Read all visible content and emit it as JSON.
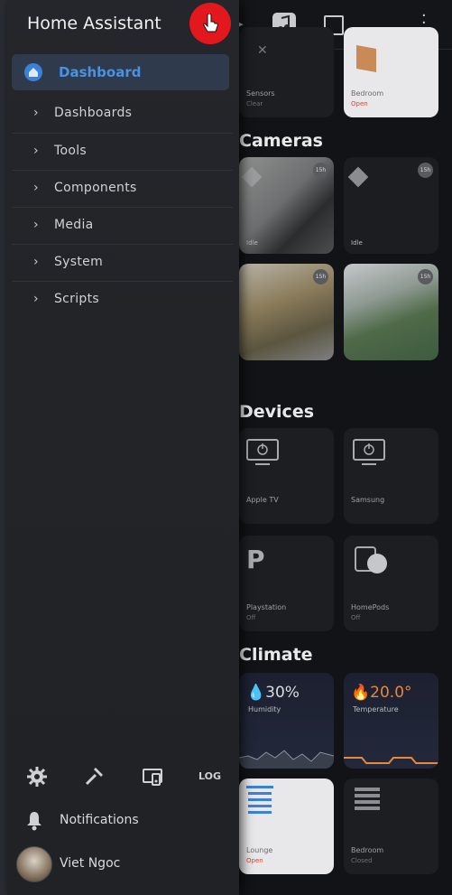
{
  "drawer": {
    "title": "Home Assistant",
    "nav": [
      {
        "label": "Dashboard",
        "active": true,
        "icon": "home-icon"
      },
      {
        "label": "Dashboards",
        "icon": "chevron-right-icon"
      },
      {
        "label": "Tools",
        "icon": "chevron-right-icon"
      },
      {
        "label": "Components",
        "icon": "chevron-right-icon"
      },
      {
        "label": "Media",
        "icon": "chevron-right-icon"
      },
      {
        "label": "System",
        "icon": "chevron-right-icon"
      },
      {
        "label": "Scripts",
        "icon": "chevron-right-icon"
      }
    ],
    "tools": [
      {
        "name": "gear-icon"
      },
      {
        "name": "hammer-icon"
      },
      {
        "name": "devices-icon"
      },
      {
        "name": "log-icon",
        "text": "LOG"
      }
    ],
    "notifications_label": "Notifications",
    "user_name": "Viet Ngoc"
  },
  "dashboard": {
    "sections": {
      "cameras": "Cameras",
      "devices": "Devices",
      "climate": "Climate"
    },
    "top_cards": [
      {
        "name": "Sensors",
        "state": "Clear"
      },
      {
        "name": "Bedroom",
        "state": "Open"
      }
    ],
    "cameras": [
      {
        "badge": "15h",
        "state": "Idle"
      },
      {
        "badge": "15h",
        "state": "Idle"
      },
      {
        "badge": "15h",
        "state": ""
      },
      {
        "badge": "15h",
        "state": ""
      }
    ],
    "devices": [
      {
        "name": "Apple TV",
        "state": ""
      },
      {
        "name": "Samsung",
        "state": ""
      },
      {
        "name": "Playstation",
        "state": "Off"
      },
      {
        "name": "HomePods",
        "state": "Off"
      }
    ],
    "climate": [
      {
        "value": "30%",
        "label": "Humidity"
      },
      {
        "value": "20.0°",
        "label": "Temperature"
      }
    ],
    "covers": [
      {
        "name": "Lounge",
        "state": "Open"
      },
      {
        "name": "Bedroom",
        "state": "Closed"
      }
    ]
  },
  "colors": {
    "accent": "#4b92e0",
    "menu_button": "#e3181f",
    "drawer_bg": "#232529",
    "open_state": "#d9453a"
  }
}
